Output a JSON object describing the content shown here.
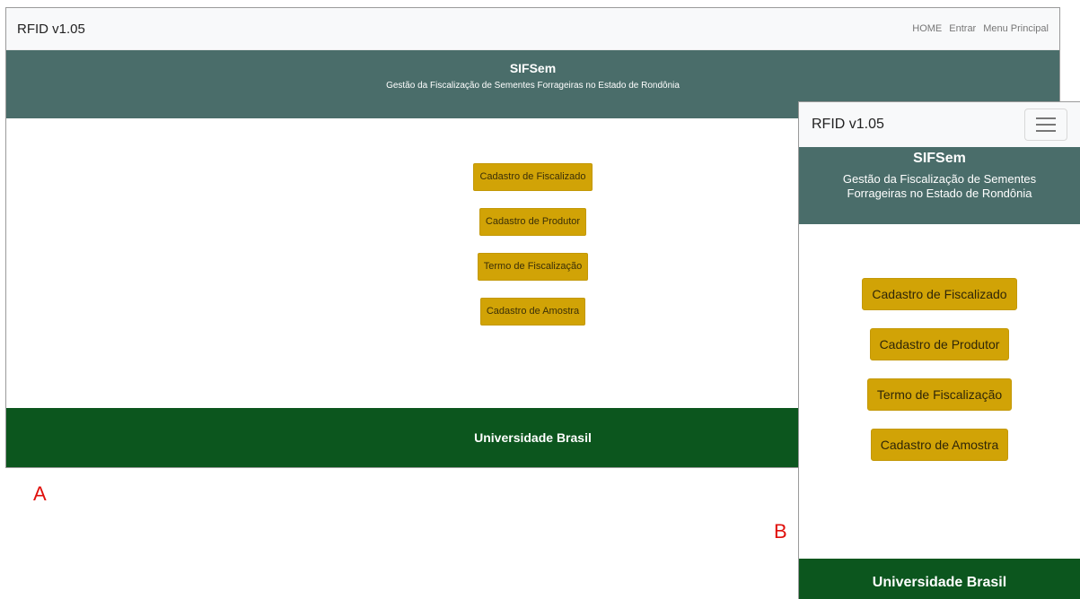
{
  "panel_a": {
    "navbar": {
      "brand": "RFID v1.05",
      "links": [
        "HOME",
        "Entrar",
        "Menu Principal"
      ]
    },
    "header": {
      "title": "SIFSem",
      "subtitle": "Gestão da Fiscalização de Sementes Forrageiras no Estado de Rondônia"
    },
    "buttons": [
      "Cadastro de Fiscalizado",
      "Cadastro de Produtor",
      "Termo de Fiscalização",
      "Cadastro de Amostra"
    ],
    "footer": "Universidade Brasil"
  },
  "panel_b": {
    "navbar": {
      "brand": "RFID v1.05",
      "toggler_icon": "hamburger-icon"
    },
    "header": {
      "title": "SIFSem",
      "subtitle": "Gestão da Fiscalização de Sementes Forrageiras no Estado de Rondônia"
    },
    "buttons": [
      "Cadastro de Fiscalizado",
      "Cadastro de Produtor",
      "Termo de Fiscalização",
      "Cadastro de Amostra"
    ],
    "footer": "Universidade Brasil"
  },
  "labels": {
    "a": "A",
    "b": "B"
  },
  "colors": {
    "header_bg": "#4a6d6a",
    "button_bg": "#d1a306",
    "footer_bg": "#0c561e",
    "label_red": "#e0100c"
  }
}
